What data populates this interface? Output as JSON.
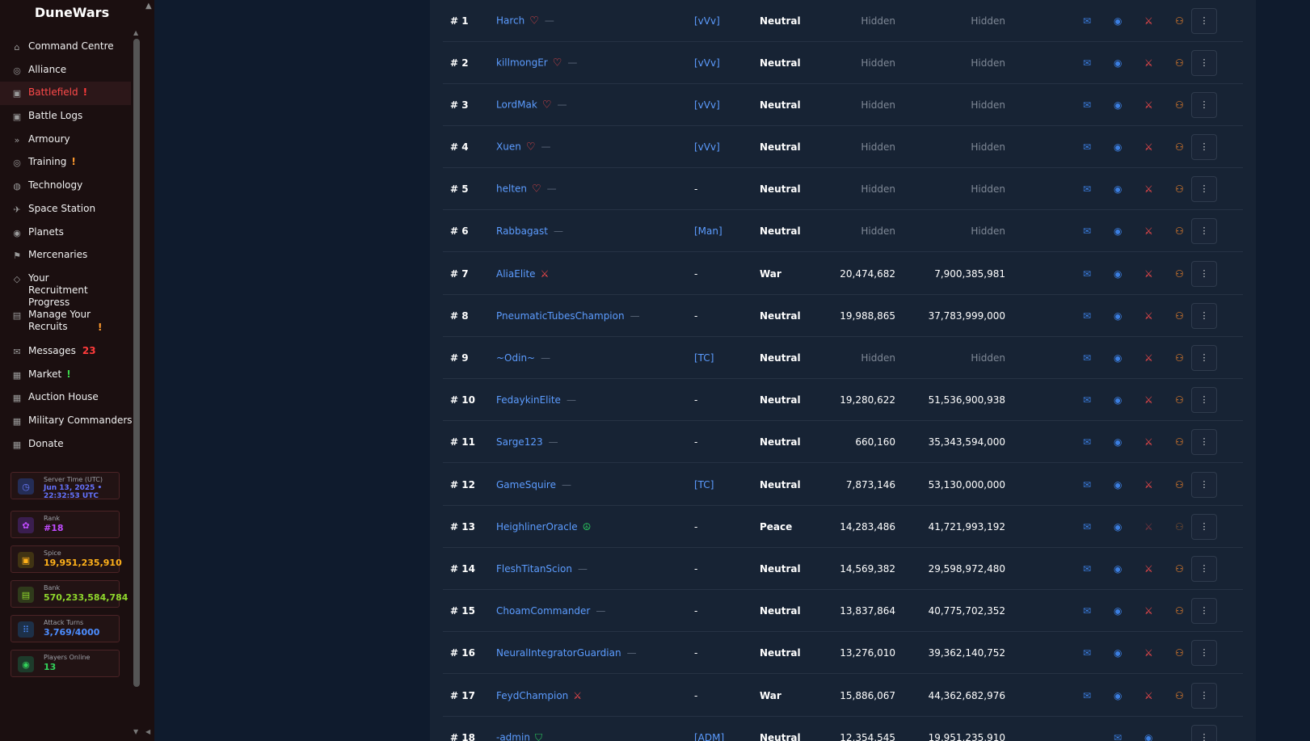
{
  "brand": "DuneWars",
  "nav": [
    {
      "icon": "home-icon",
      "glyph": "⌂",
      "label": "Command Centre",
      "flag": ""
    },
    {
      "icon": "alliance-icon",
      "glyph": "◎",
      "label": "Alliance",
      "flag": ""
    },
    {
      "icon": "battlefield-icon",
      "glyph": "▣",
      "label": "Battlefield",
      "flag": "!",
      "flag_color": "red",
      "active": true
    },
    {
      "icon": "logs-icon",
      "glyph": "▣",
      "label": "Battle Logs",
      "flag": ""
    },
    {
      "icon": "armoury-icon",
      "glyph": "»",
      "label": "Armoury",
      "flag": ""
    },
    {
      "icon": "training-icon",
      "glyph": "◎",
      "label": "Training",
      "flag": "!",
      "flag_color": "orange"
    },
    {
      "icon": "technology-icon",
      "glyph": "◍",
      "label": "Technology",
      "flag": ""
    },
    {
      "icon": "space-station-icon",
      "glyph": "✈",
      "label": "Space Station",
      "flag": ""
    },
    {
      "icon": "planets-icon",
      "glyph": "◉",
      "label": "Planets",
      "flag": ""
    },
    {
      "icon": "mercenaries-icon",
      "glyph": "⚑",
      "label": "Mercenaries",
      "flag": ""
    },
    {
      "icon": "recruitment-icon",
      "glyph": "◇",
      "label": "Your Recruitment Progress",
      "flag": "",
      "tall": true
    },
    {
      "icon": "recruits-icon",
      "glyph": "▤",
      "label": "Manage Your Recruits",
      "flag": "!",
      "flag_color": "orange",
      "tall": true
    },
    {
      "icon": "messages-icon",
      "glyph": "✉",
      "label": "Messages",
      "count": "23"
    },
    {
      "icon": "market-icon",
      "glyph": "▦",
      "label": "Market",
      "flag": "!",
      "flag_color": "green"
    },
    {
      "icon": "auction-icon",
      "glyph": "▦",
      "label": "Auction House",
      "flag": ""
    },
    {
      "icon": "commanders-icon",
      "glyph": "▦",
      "label": "Military Commanders",
      "flag": ""
    },
    {
      "icon": "donate-icon",
      "glyph": "▦",
      "label": "Donate",
      "flag": ""
    }
  ],
  "stats": {
    "server_time": {
      "title": "Server Time (UTC)",
      "value": "Jun 13, 2025 • 22:32:53 UTC",
      "color": "#5d6dff"
    },
    "rank": {
      "title": "Rank",
      "value": "#18",
      "color": "#c14cff"
    },
    "spice": {
      "title": "Spice",
      "value": "19,951,235,910",
      "color": "#ffb11a"
    },
    "bank": {
      "title": "Bank",
      "value": "570,233,584,784",
      "color": "#8fd82c"
    },
    "attack_turns": {
      "title": "Attack Turns",
      "value": "3,769/4000",
      "color": "#4c8dff"
    },
    "players_online": {
      "title": "Players Online",
      "value": "13",
      "color": "#32d25a"
    }
  },
  "rows": [
    {
      "rank": "# 1",
      "name": "Harch",
      "mark": "heart",
      "alliance": "[vVv]",
      "status": "Neutral",
      "v1": "Hidden",
      "v2": "Hidden"
    },
    {
      "rank": "# 2",
      "name": "killmongEr",
      "mark": "heart",
      "alliance": "[vVv]",
      "status": "Neutral",
      "v1": "Hidden",
      "v2": "Hidden"
    },
    {
      "rank": "# 3",
      "name": "LordMak",
      "mark": "heart",
      "alliance": "[vVv]",
      "status": "Neutral",
      "v1": "Hidden",
      "v2": "Hidden"
    },
    {
      "rank": "# 4",
      "name": "Xuen",
      "mark": "heart",
      "alliance": "[vVv]",
      "status": "Neutral",
      "v1": "Hidden",
      "v2": "Hidden"
    },
    {
      "rank": "# 5",
      "name": "helten",
      "mark": "heart",
      "alliance": "-",
      "status": "Neutral",
      "v1": "Hidden",
      "v2": "Hidden"
    },
    {
      "rank": "# 6",
      "name": "Rabbagast",
      "mark": "",
      "alliance": "[Man]",
      "status": "Neutral",
      "v1": "Hidden",
      "v2": "Hidden"
    },
    {
      "rank": "# 7",
      "name": "AliaElite",
      "mark": "sword",
      "alliance": "-",
      "status": "War",
      "v1": "20,474,682",
      "v2": "7,900,385,981"
    },
    {
      "rank": "# 8",
      "name": "PneumaticTubesChampion",
      "mark": "",
      "alliance": "-",
      "status": "Neutral",
      "v1": "19,988,865",
      "v2": "37,783,999,000"
    },
    {
      "rank": "# 9",
      "name": "~Odin~",
      "mark": "",
      "alliance": "[TC]",
      "status": "Neutral",
      "v1": "Hidden",
      "v2": "Hidden"
    },
    {
      "rank": "# 10",
      "name": "FedaykinElite",
      "mark": "",
      "alliance": "-",
      "status": "Neutral",
      "v1": "19,280,622",
      "v2": "51,536,900,938"
    },
    {
      "rank": "# 11",
      "name": "Sarge123",
      "mark": "",
      "alliance": "-",
      "status": "Neutral",
      "v1": "660,160",
      "v2": "35,343,594,000"
    },
    {
      "rank": "# 12",
      "name": "GameSquire",
      "mark": "",
      "alliance": "[TC]",
      "status": "Neutral",
      "v1": "7,873,146",
      "v2": "53,130,000,000"
    },
    {
      "rank": "# 13",
      "name": "HeighlinerOracle",
      "mark": "peace",
      "alliance": "-",
      "status": "Peace",
      "v1": "14,283,486",
      "v2": "41,721,993,192",
      "disabled": true
    },
    {
      "rank": "# 14",
      "name": "FleshTitanScion",
      "mark": "",
      "alliance": "-",
      "status": "Neutral",
      "v1": "14,569,382",
      "v2": "29,598,972,480"
    },
    {
      "rank": "# 15",
      "name": "ChoamCommander",
      "mark": "",
      "alliance": "-",
      "status": "Neutral",
      "v1": "13,837,864",
      "v2": "40,775,702,352"
    },
    {
      "rank": "# 16",
      "name": "NeuralIntegratorGuardian",
      "mark": "",
      "alliance": "-",
      "status": "Neutral",
      "v1": "13,276,010",
      "v2": "39,362,140,752"
    },
    {
      "rank": "# 17",
      "name": "FeydChampion",
      "mark": "sword",
      "alliance": "-",
      "status": "War",
      "v1": "15,886,067",
      "v2": "44,362,682,976"
    },
    {
      "rank": "# 18",
      "name": "-admin",
      "mark": "shield",
      "alliance": "[ADM]",
      "status": "Neutral",
      "v1": "12,354,545",
      "v2": "19,951,235,910",
      "self": true
    }
  ]
}
